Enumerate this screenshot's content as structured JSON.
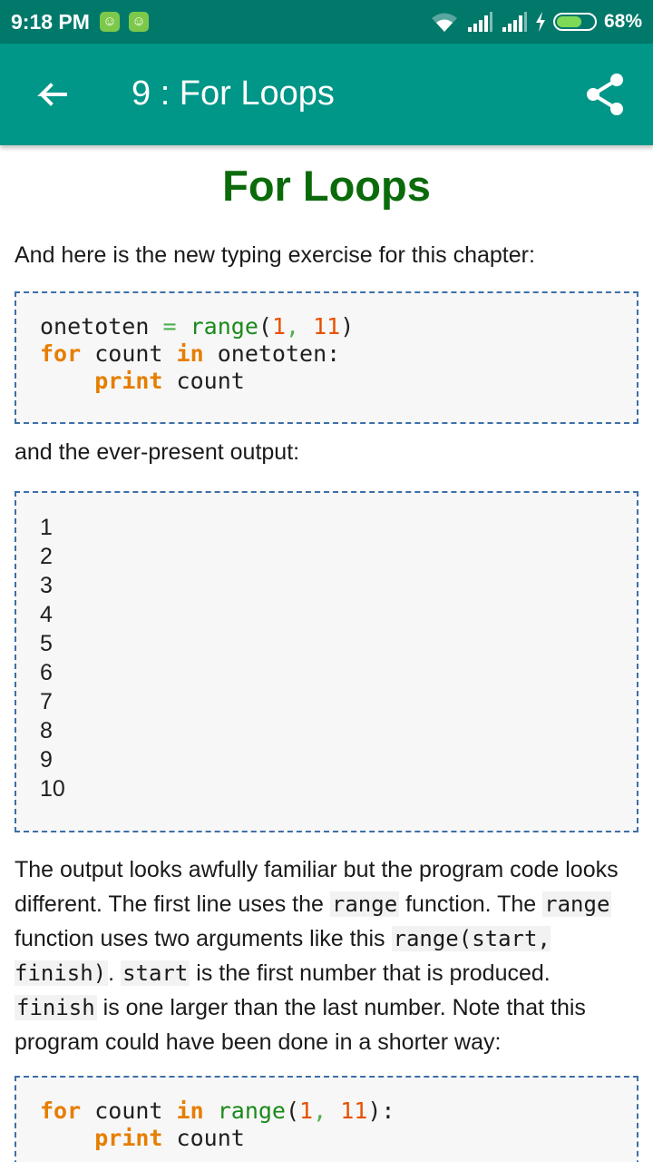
{
  "status_bar": {
    "time": "9:18 PM",
    "battery_percent": "68%",
    "battery_level": 0.68
  },
  "app_bar": {
    "title": "9 : For Loops",
    "back_icon": "arrow-left-icon",
    "share_icon": "share-icon"
  },
  "page": {
    "heading": "For Loops",
    "intro": "And here is the new typing exercise for this chapter:",
    "code1": {
      "l1_var": "onetoten",
      "l1_eq": "=",
      "l1_fn": "range",
      "l1_open": "(",
      "l1_n1": "1",
      "l1_comma": ",",
      "l1_n2": "11",
      "l1_close": ")",
      "l2_for": "for",
      "l2_var": "count",
      "l2_in": "in",
      "l2_rest": "onetoten:",
      "l3_print": "print",
      "l3_var": "count"
    },
    "output_intro": "and the ever-present output:",
    "output_lines": [
      "1",
      "2",
      "3",
      "4",
      "5",
      "6",
      "7",
      "8",
      "9",
      "10"
    ],
    "explain": {
      "t1": "The output looks awfully familiar but the program code looks different. The first line uses the",
      "c1": "range",
      "t2": "function. The",
      "c2": "range",
      "t3": "function uses two arguments like this",
      "c3": "range(start, finish)",
      "t4": ".",
      "c4": "start",
      "t5": "is the first number that is produced.",
      "c5": "finish",
      "t6": "is one larger than the last number. Note that this program could have been done in a shorter way:"
    },
    "code3": {
      "l1_for": "for",
      "l1_var": "count",
      "l1_in": "in",
      "l1_fn": "range",
      "l1_open": "(",
      "l1_n1": "1",
      "l1_comma": ",",
      "l1_n2": "11",
      "l1_close": "):",
      "l2_print": "print",
      "l2_var": "count"
    }
  }
}
